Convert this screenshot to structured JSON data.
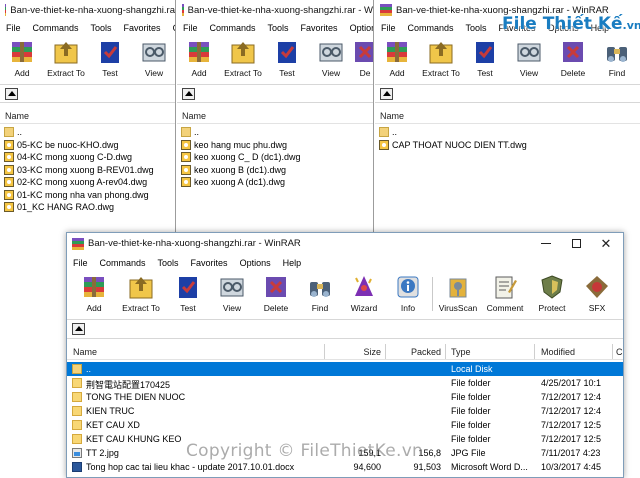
{
  "watermark": {
    "logo_main": "File Thiết Kế",
    "logo_suffix": ".vn",
    "copyright": "Copyright © FileThietKe.vn"
  },
  "toolbar_icons": {
    "add": {
      "colors": [
        "#7a4fbf",
        "#2e9c57",
        "#d93a3a",
        "#e7b43b"
      ]
    },
    "extract": {
      "colors": [
        "#f0c64a",
        "#8a6b23"
      ]
    },
    "test": {
      "colors": [
        "#1d3fa6",
        "#c73b3b"
      ]
    },
    "view": {
      "colors": [
        "#cfd7de",
        "#4b5a68"
      ]
    },
    "delete": {
      "colors": [
        "#6b4bb0",
        "#c83b3b"
      ]
    },
    "find": {
      "colors": [
        "#4b6078",
        "#d9b65a"
      ]
    },
    "wizard": {
      "colors": [
        "#7d2fb3",
        "#e04848"
      ]
    },
    "info": {
      "colors": [
        "#3b78c2",
        "#e0e0e0"
      ]
    },
    "virusscan": {
      "colors": [
        "#7a8a9a",
        "#e3b23c"
      ]
    },
    "comment": {
      "colors": [
        "#f2f2e8",
        "#5b5b5b"
      ]
    },
    "protect": {
      "colors": [
        "#6e7e4a",
        "#d8c05b"
      ]
    },
    "sfx": {
      "colors": [
        "#8a6b3a",
        "#c63838"
      ]
    }
  },
  "win1": {
    "title": "Ban-ve-thiet-ke-nha-xuong-shangzhi.ra",
    "menu": [
      "File",
      "Commands",
      "Tools",
      "Favorites",
      "Op"
    ],
    "toolbar": [
      "Add",
      "Extract To",
      "Test",
      "View"
    ],
    "column_name": "Name",
    "files": [
      {
        "name": "..",
        "type": "up"
      },
      {
        "name": "05-KC be nuoc-KHO.dwg",
        "type": "dwg"
      },
      {
        "name": "04-KC mong xuong C-D.dwg",
        "type": "dwg"
      },
      {
        "name": "03-KC mong xuong B-REV01.dwg",
        "type": "dwg"
      },
      {
        "name": "02-KC mong xuong A-rev04.dwg",
        "type": "dwg"
      },
      {
        "name": "01-KC mong nha van phong.dwg",
        "type": "dwg"
      },
      {
        "name": "01_KC HANG RAO.dwg",
        "type": "dwg"
      }
    ]
  },
  "win2": {
    "title": "Ban-ve-thiet-ke-nha-xuong-shangzhi.rar - W",
    "menu": [
      "File",
      "Commands",
      "Tools",
      "Favorites",
      "Options"
    ],
    "toolbar": [
      "Add",
      "Extract To",
      "Test",
      "View",
      "De"
    ],
    "column_name": "Name",
    "files": [
      {
        "name": "..",
        "type": "up"
      },
      {
        "name": "keo hang muc phu.dwg",
        "type": "dwg"
      },
      {
        "name": "keo xuong C_ D (dc1).dwg",
        "type": "dwg"
      },
      {
        "name": "keo xuong B (dc1).dwg",
        "type": "dwg"
      },
      {
        "name": "keo xuong A (dc1).dwg",
        "type": "dwg"
      }
    ]
  },
  "win3": {
    "title": "Ban-ve-thiet-ke-nha-xuong-shangzhi.rar - WinRAR",
    "menu": [
      "File",
      "Commands",
      "Tools",
      "Favorites",
      "Options",
      "Help"
    ],
    "toolbar": [
      "Add",
      "Extract To",
      "Test",
      "View",
      "Delete",
      "Find"
    ],
    "column_name": "Name",
    "files": [
      {
        "name": "..",
        "type": "up"
      },
      {
        "name": "CAP THOAT NUOC DIEN TT.dwg",
        "type": "dwg"
      }
    ]
  },
  "win4": {
    "title": "Ban-ve-thiet-ke-nha-xuong-shangzhi.rar - WinRAR",
    "menu": [
      "File",
      "Commands",
      "Tools",
      "Favorites",
      "Options",
      "Help"
    ],
    "toolbar": [
      "Add",
      "Extract To",
      "Test",
      "View",
      "Delete",
      "Find",
      "Wizard",
      "Info",
      "VirusScan",
      "Comment",
      "Protect",
      "SFX"
    ],
    "columns": [
      "Name",
      "Size",
      "Packed",
      "Type",
      "Modified",
      "C"
    ],
    "files": [
      {
        "name": "..",
        "size": "",
        "packed": "",
        "type": "Local Disk",
        "modified": "",
        "kind": "up",
        "selected": true
      },
      {
        "name": "荆智電站配置170425",
        "size": "",
        "packed": "",
        "type": "File folder",
        "modified": "4/25/2017 10:1",
        "kind": "folder"
      },
      {
        "name": "TONG THE DIEN NUOC",
        "size": "",
        "packed": "",
        "type": "File folder",
        "modified": "7/12/2017 12:4",
        "kind": "folder"
      },
      {
        "name": "KIEN TRUC",
        "size": "",
        "packed": "",
        "type": "File folder",
        "modified": "7/12/2017 12:4",
        "kind": "folder"
      },
      {
        "name": "KET CAU XD",
        "size": "",
        "packed": "",
        "type": "File folder",
        "modified": "7/12/2017 12:5",
        "kind": "folder"
      },
      {
        "name": "KET CAU KHUNG KEO",
        "size": "",
        "packed": "",
        "type": "File folder",
        "modified": "7/12/2017 12:5",
        "kind": "folder"
      },
      {
        "name": "TT 2.jpg",
        "size": "159,1",
        "packed": "156,8",
        "type": "JPG File",
        "modified": "7/11/2017 4:23",
        "kind": "jpg"
      },
      {
        "name": "Tong hop cac tai lieu khac - update 2017.10.01.docx",
        "size": "94,600",
        "packed": "91,503",
        "type": "Microsoft Word D...",
        "modified": "10/3/2017 4:45",
        "kind": "docx"
      }
    ]
  }
}
